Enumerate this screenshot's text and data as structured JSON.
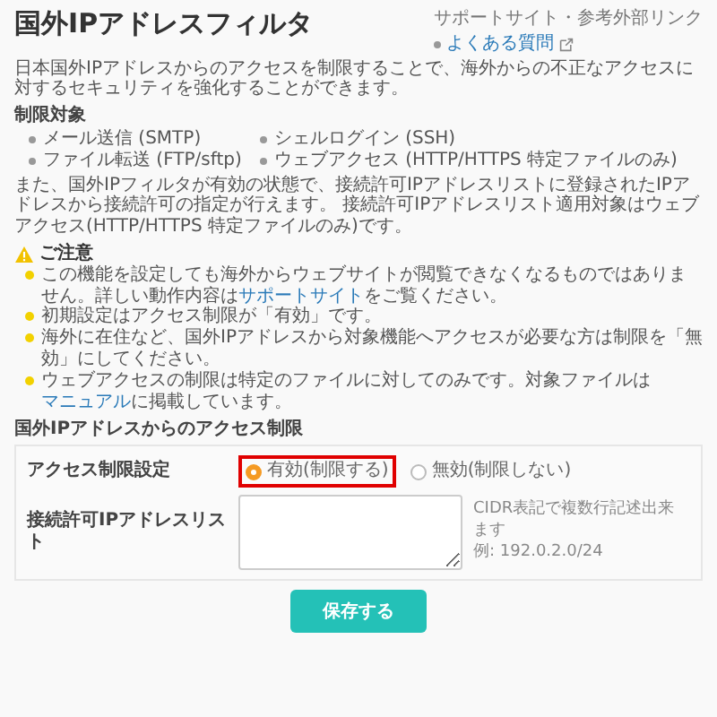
{
  "title": "国外IPアドレスフィルタ",
  "sidebar": {
    "heading": "サポートサイト・参考外部リンク",
    "links": [
      {
        "label": "よくある質問"
      }
    ]
  },
  "intro": "日本国外IPアドレスからのアクセスを制限することで、海外からの不正なアクセスに対するセキュリティを強化することができます。",
  "targets_heading": "制限対象",
  "targets": [
    "メール送信 (SMTP)",
    "ファイル転送 (FTP/sftp)",
    "シェルログイン (SSH)",
    "ウェブアクセス (HTTP/HTTPS 特定ファイルのみ)"
  ],
  "description": "また、国外IPフィルタが有効の状態で、接続許可IPアドレスリストに登録されたIPアドレスから接続許可の指定が行えます。 接続許可IPアドレスリスト適用対象はウェブアクセス(HTTP/HTTPS 特定ファイルのみ)です。",
  "caution": {
    "heading": "ご注意",
    "notes": [
      {
        "parts": [
          {
            "text": "この機能を設定しても海外からウェブサイトが閲覧できなくなるものではありません。詳しい動作内容は"
          },
          {
            "text": "サポートサイト",
            "link": true
          },
          {
            "text": "をご覧ください。"
          }
        ]
      },
      {
        "parts": [
          {
            "text": "初期設定はアクセス制限が「有効」です。"
          }
        ]
      },
      {
        "parts": [
          {
            "text": "海外に在住など、国外IPアドレスから対象機能へアクセスが必要な方は制限を「無効」にしてください。"
          }
        ]
      },
      {
        "parts": [
          {
            "text": "ウェブアクセスの制限は特定のファイルに対してのみです。対象ファイルは"
          },
          {
            "text": "マニュアル",
            "link": true
          },
          {
            "text": "に掲載しています。"
          }
        ]
      }
    ]
  },
  "form": {
    "heading": "国外IPアドレスからのアクセス制限",
    "restriction": {
      "label": "アクセス制限設定",
      "options": [
        {
          "label": "有効(制限する)",
          "selected": true
        },
        {
          "label": "無効(制限しない)",
          "selected": false
        }
      ]
    },
    "allowlist": {
      "label": "接続許可IPアドレスリスト",
      "hint": "CIDR表記で複数行記述出来ます",
      "example": "例: 192.0.2.0/24"
    }
  },
  "save_button": "保存する"
}
